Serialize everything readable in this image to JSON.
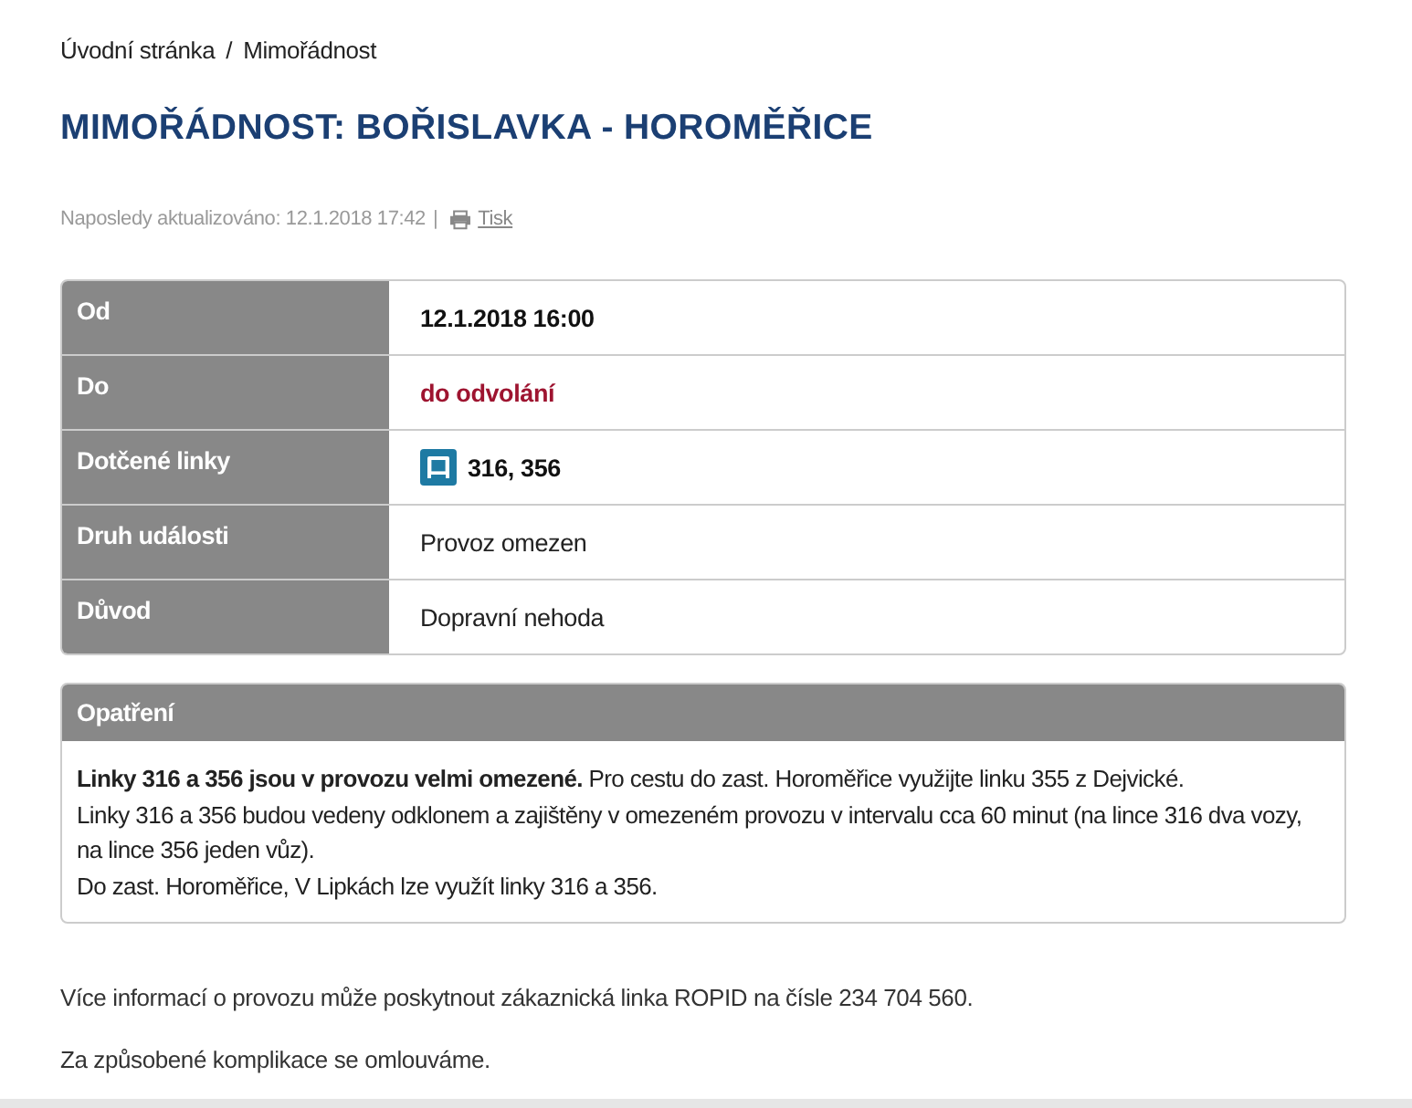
{
  "breadcrumb": {
    "items": [
      "Úvodní stránka",
      "Mimořádnost"
    ],
    "separator": "/"
  },
  "title": "MIMOŘÁDNOST: BOŘISLAVKA - HOROMĚŘICE",
  "meta": {
    "updated": "Naposledy aktualizováno: 12.1.2018 17:42",
    "separator": "|",
    "print_link": "Tisk"
  },
  "details": [
    {
      "label": "Od",
      "value": "12.1.2018 16:00",
      "kind": "strong"
    },
    {
      "label": "Do",
      "value": "do odvolání",
      "kind": "alert"
    },
    {
      "label": "Dotčené linky",
      "value": "316, 356",
      "kind": "bus_lines"
    },
    {
      "label": "Druh události",
      "value": "Provoz omezen",
      "kind": "plain"
    },
    {
      "label": "Důvod",
      "value": "Dopravní nehoda",
      "kind": "plain"
    }
  ],
  "measures": {
    "heading": "Opatření",
    "lines": [
      "**Linky 316 a 356 jsou v provozu velmi omezené.** Pro cestu do zast. Horoměřice využijte linku 355 z Dejvické.",
      "Linky 316 a 356 budou vedeny odklonem a zajištěny v omezeném provozu v intervalu cca 60 minut (na lince 316 dva vozy, na lince 356 jeden vůz).",
      "Do zast. Horoměřice, V Lipkách lze využít linky 316 a 356."
    ]
  },
  "footer_notes": [
    "Více informací o provozu může poskytnout zákaznická linka ROPID na čísle 234 704 560.",
    "Za způsobené komplikace se omlouváme."
  ]
}
